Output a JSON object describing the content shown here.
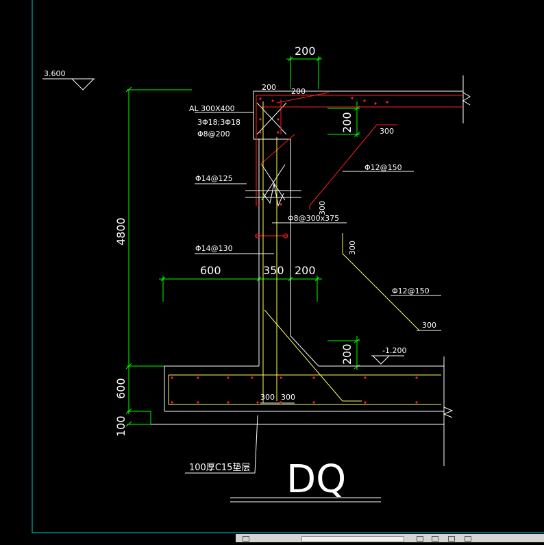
{
  "drawing": {
    "title": "DQ",
    "level_top": "3.600",
    "level_bottom": "-1.200",
    "beam": {
      "name": "AL 300X400",
      "bars": "3Φ18;3Φ18",
      "stirrups": "Φ8@200"
    },
    "rebar": {
      "vert_top": "Φ14@125",
      "vert_bottom": "Φ14@130",
      "tie": "Φ8@300x375",
      "haunch_upper": "Φ12@150",
      "haunch_lower": "Φ12@150"
    },
    "dimensions": {
      "d200_top": "200",
      "d200_beam_left": "200",
      "d200_beam_right": "200",
      "d200_haunch_v": "200",
      "d300_upper": "300",
      "d300_upper_v": "300",
      "d300_lower_v": "300",
      "d300_lower": "300",
      "height_4800": "4800",
      "d600_left": "600",
      "d350": "350",
      "d200_mid": "200",
      "d200_bottom_v": "200",
      "height_600": "600",
      "height_100": "100",
      "d300_base_a": "300",
      "d300_base_b": "300"
    },
    "cushion_note": "100厚C15垫层"
  },
  "colors": {
    "background": "#000000",
    "line": "#ffffff",
    "dim_line": "#00ff00",
    "rebar": "#ff2020",
    "haunch_bar": "#ffff60",
    "frame": "#00c8c8"
  },
  "statusbar": {
    "icons": [
      "snap-icon",
      "grid-icon",
      "ortho-icon",
      "polar-icon",
      "osnap-icon"
    ]
  }
}
